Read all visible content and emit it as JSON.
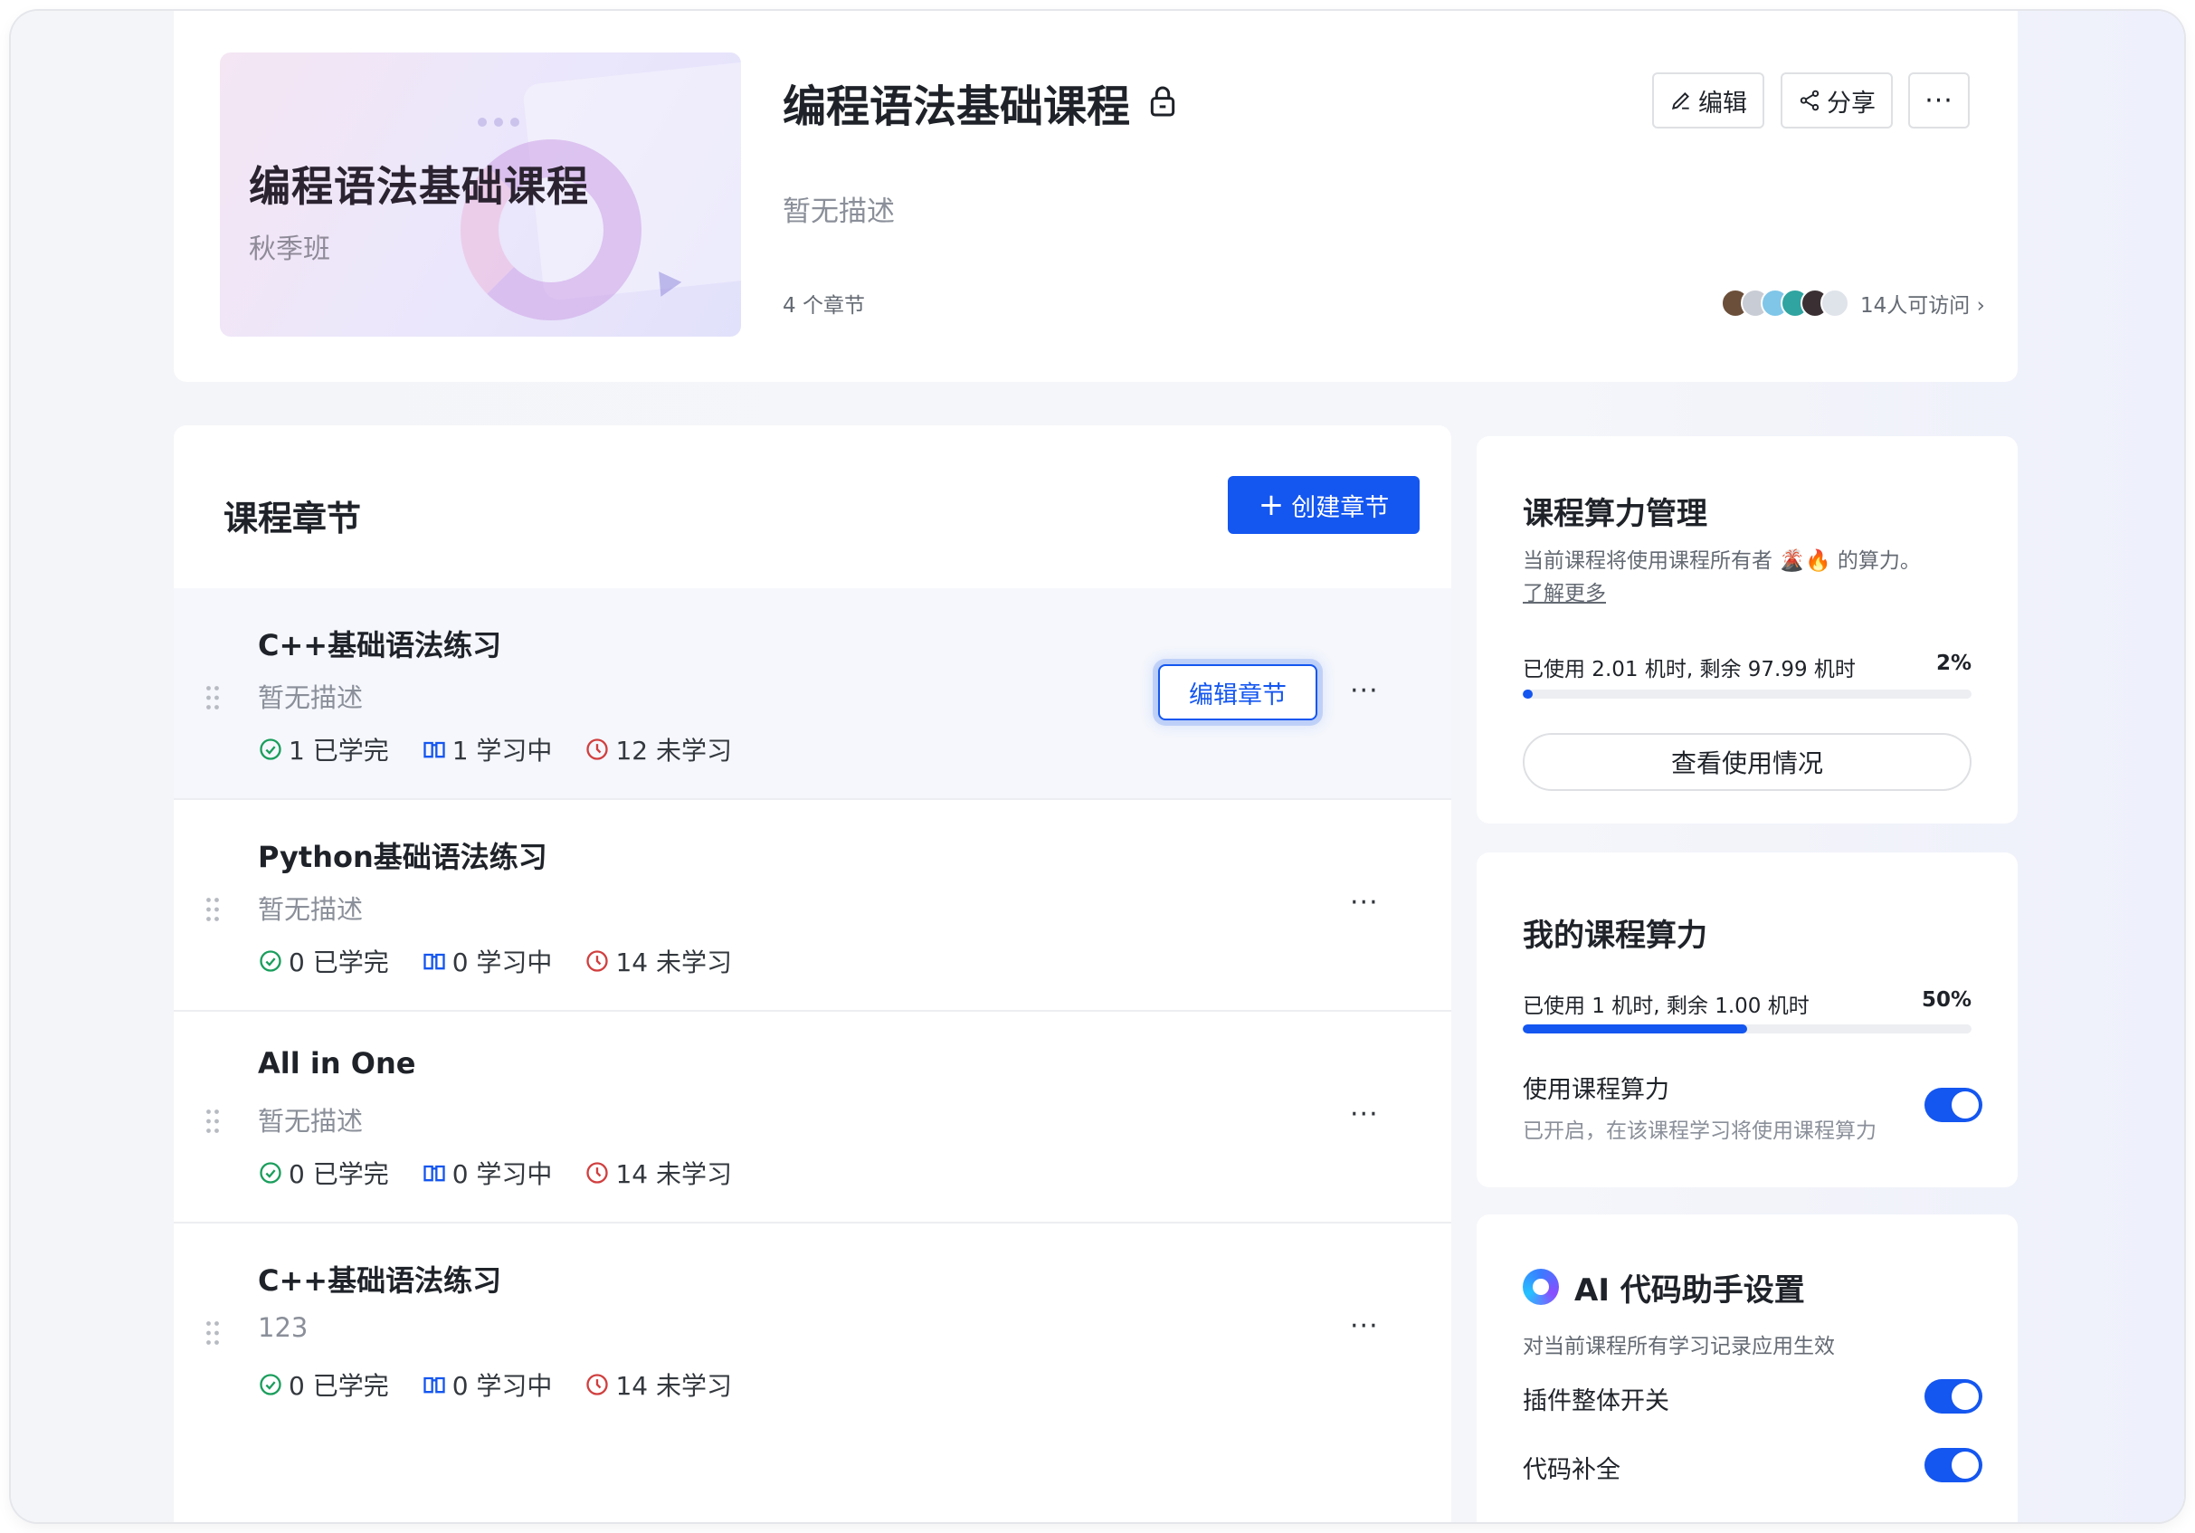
{
  "header": {
    "cover_title": "编程语法基础课程",
    "cover_subtitle": "秋季班",
    "title": "编程语法基础课程",
    "description": "暂无描述",
    "chapter_count": "4 个章节",
    "edit_label": "编辑",
    "share_label": "分享",
    "more_label": "···",
    "visitors_text": "14人可访问 ›"
  },
  "chapters": {
    "heading": "课程章节",
    "create_label": "创建章节",
    "edit_chapter_label": "编辑章节",
    "more_label": "···",
    "items": [
      {
        "title": "C++基础语法练习",
        "desc": "暂无描述",
        "done": "1 已学完",
        "learning": "1 学习中",
        "todo": "12 未学习"
      },
      {
        "title": "Python基础语法练习",
        "desc": "暂无描述",
        "done": "0 已学完",
        "learning": "0 学习中",
        "todo": "14 未学习"
      },
      {
        "title": "All in One",
        "desc": "暂无描述",
        "done": "0 已学完",
        "learning": "0 学习中",
        "todo": "14 未学习"
      },
      {
        "title": "C++基础语法练习",
        "desc": "123",
        "done": "0 已学完",
        "learning": "0 学习中",
        "todo": "14 未学习"
      }
    ]
  },
  "compute": {
    "title": "课程算力管理",
    "subtitle": "当前课程将使用课程所有者 🌋🔥 的算力。",
    "learn_more": "了解更多",
    "usage_text": "已使用 2.01 机时, 剩余 97.99 机时",
    "usage_pct": "2%",
    "usage_fraction": 0.02,
    "view_usage_label": "查看使用情况"
  },
  "my_compute": {
    "title": "我的课程算力",
    "usage_text": "已使用 1 机时, 剩余 1.00 机时",
    "usage_pct": "50%",
    "usage_fraction": 0.5,
    "toggle_label": "使用课程算力",
    "toggle_sub": "已开启，在该课程学习将使用课程算力",
    "toggle_on": true
  },
  "ai": {
    "title": "AI 代码助手设置",
    "subtitle": "对当前课程所有学习记录应用生效",
    "plugin_label": "插件整体开关",
    "plugin_on": true,
    "complete_label": "代码补全",
    "complete_on": true
  },
  "colors": {
    "primary": "#1456f0",
    "done": "#1a9e5c",
    "learning": "#1456f0",
    "todo": "#d13f3f"
  }
}
